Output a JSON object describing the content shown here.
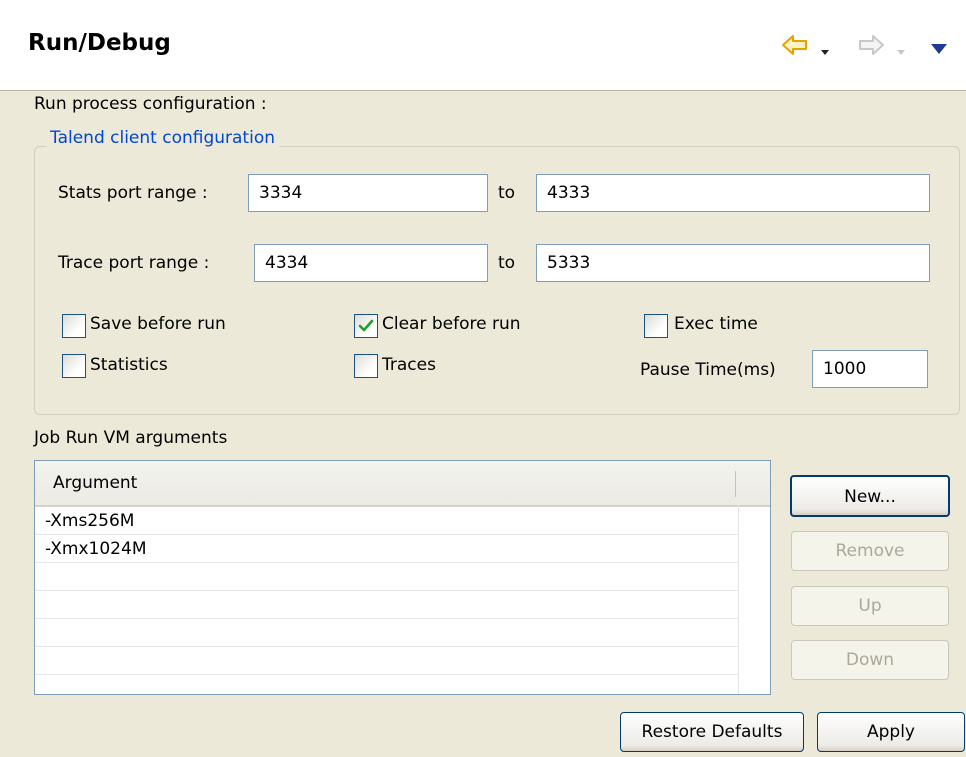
{
  "header": {
    "title": "Run/Debug",
    "icons": {
      "back": "back-arrow-icon",
      "forward": "forward-arrow-icon",
      "menu": "view-menu-icon"
    },
    "back_color": "#e8a200",
    "forward_color": "#c8c8c8"
  },
  "section_label": "Run process configuration :",
  "client_config": {
    "legend": "Talend client configuration",
    "stats_label": "Stats port range :",
    "stats_from": "3334",
    "stats_to_label": "to",
    "stats_to": "4333",
    "trace_label": "Trace port range :",
    "trace_from": "4334",
    "trace_to_label": "to",
    "trace_to": "5333",
    "checkboxes": {
      "save_before_run": {
        "label": "Save before run",
        "checked": false
      },
      "clear_before_run": {
        "label": "Clear before run",
        "checked": true
      },
      "exec_time": {
        "label": "Exec time",
        "checked": false
      },
      "statistics": {
        "label": "Statistics",
        "checked": false
      },
      "traces": {
        "label": "Traces",
        "checked": false
      }
    },
    "pause_label": "Pause Time(ms)",
    "pause_value": "1000"
  },
  "vm_args": {
    "label": "Job Run VM arguments",
    "column_header": "Argument",
    "rows": [
      "-Xms256M",
      "-Xmx1024M",
      "",
      "",
      "",
      "",
      ""
    ]
  },
  "buttons": {
    "new": "New...",
    "remove": "Remove",
    "up": "Up",
    "down": "Down",
    "restore_defaults": "Restore Defaults",
    "apply": "Apply"
  }
}
